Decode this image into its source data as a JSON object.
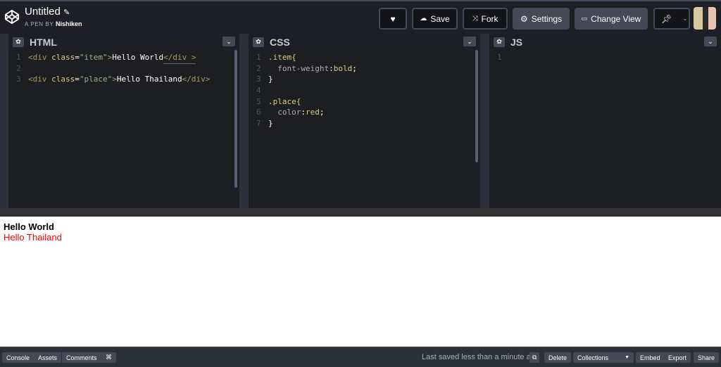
{
  "header": {
    "title": "Untitled",
    "by_label": "A PEN BY",
    "author": "Nishiken",
    "buttons": {
      "save": "Save",
      "fork": "Fork",
      "settings": "Settings",
      "change_view": "Change View"
    }
  },
  "panels": {
    "html": {
      "title": "HTML",
      "lines": [
        "1",
        "2",
        "3"
      ]
    },
    "css": {
      "title": "CSS",
      "lines": [
        "1",
        "2",
        "3",
        "4",
        "5",
        "6",
        "7"
      ]
    },
    "js": {
      "title": "JS",
      "lines": [
        "1"
      ]
    }
  },
  "code": {
    "html": {
      "l1": [
        "<div ",
        "class",
        "=",
        "\"item\"",
        ">",
        "Hello World",
        "</div >"
      ],
      "l3": [
        "<div ",
        "class",
        "=",
        "\"place\"",
        ">",
        "Hello Thailand",
        "</div>"
      ]
    },
    "css": {
      "sel1": ".item{",
      "prop1": "font-weight",
      ":": ":",
      "val1": "bold",
      ";": ";",
      "close": "}",
      "sel2": ".place{",
      "prop2": "color",
      "val2": "red"
    }
  },
  "preview": {
    "line1": "Hello World",
    "line2": "Hello Thailand",
    "accent": "#ff0000"
  },
  "footer": {
    "console": "Console",
    "assets": "Assets",
    "comments": "Comments",
    "cmd": "⌘",
    "saved": "Last saved less than a minute ago",
    "delete": "Delete",
    "collections": "Collections",
    "embed": "Embed",
    "export": "Export",
    "share": "Share"
  }
}
